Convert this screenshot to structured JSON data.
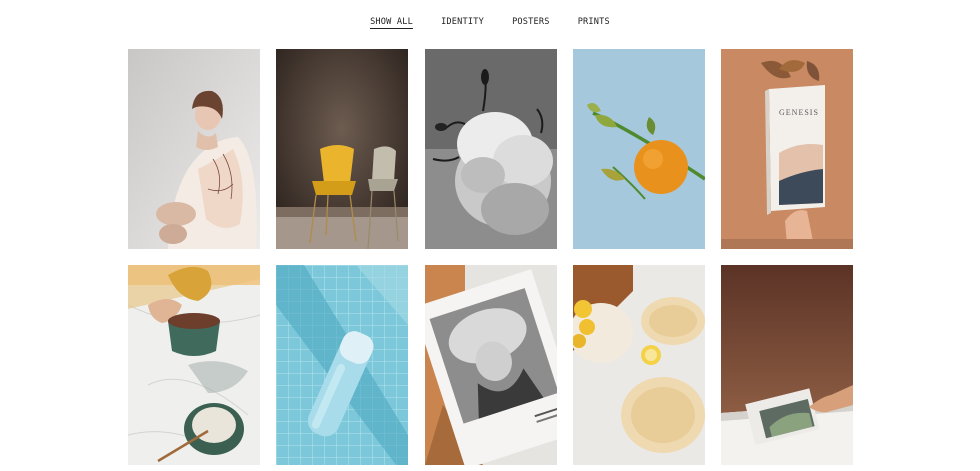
{
  "filters": {
    "show_all": "SHOW ALL",
    "identity": "IDENTITY",
    "posters": "POSTERS",
    "prints": "PRINTS"
  },
  "active_filter": "SHOW ALL",
  "portfolio": {
    "items": [
      {
        "icon": "woman-photo"
      },
      {
        "icon": "chairs-photo"
      },
      {
        "icon": "flower-photo"
      },
      {
        "icon": "orange-photo"
      },
      {
        "icon": "genesis-book-photo",
        "text": "GENESIS"
      },
      {
        "icon": "mug-photo"
      },
      {
        "icon": "bottle-photo"
      },
      {
        "icon": "poster-photo"
      },
      {
        "icon": "lemon-plates-photo"
      },
      {
        "icon": "magazine-photo"
      }
    ]
  }
}
